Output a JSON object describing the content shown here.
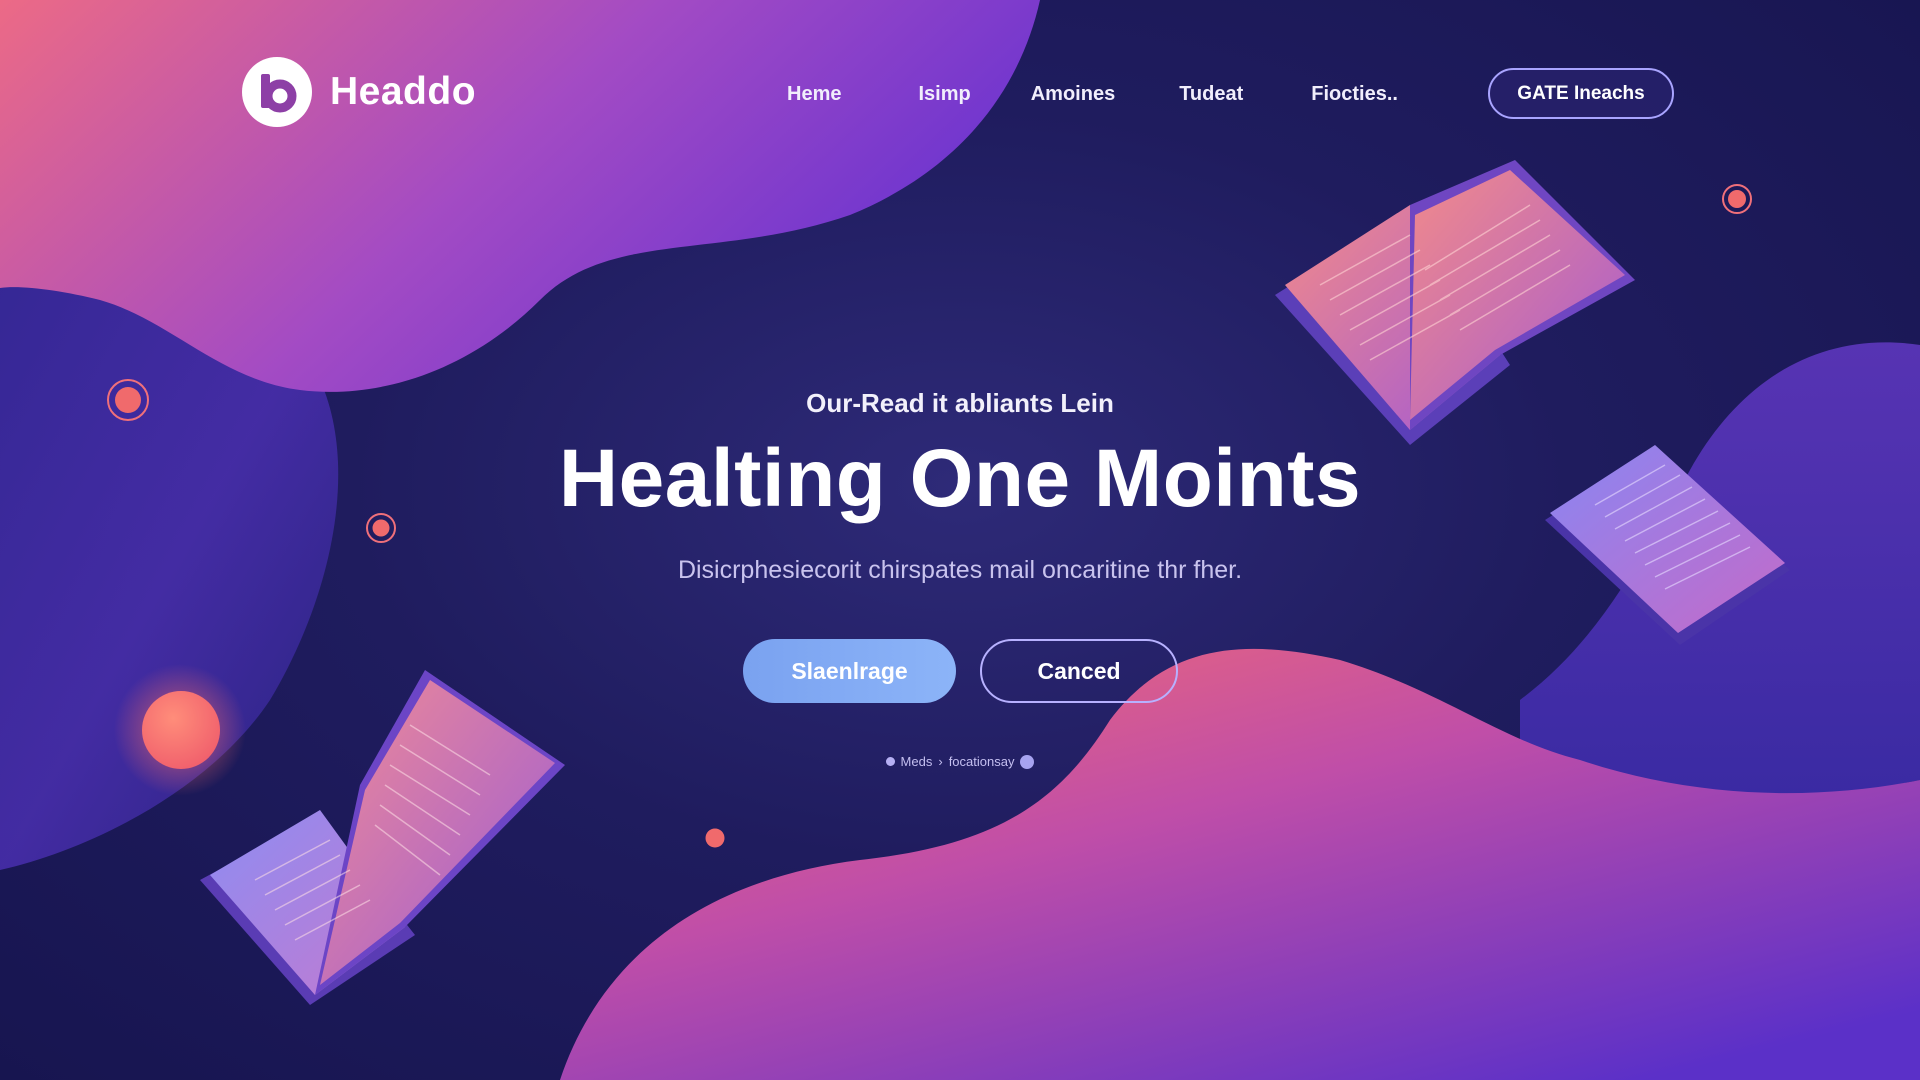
{
  "brand": {
    "name": "Headdo",
    "logo_icon": "b-letter-logo"
  },
  "nav": {
    "links": [
      {
        "label": "Heme"
      },
      {
        "label": "Isimp"
      },
      {
        "label": "Amoines"
      },
      {
        "label": "Tudeat"
      },
      {
        "label": "Fiocties.."
      }
    ],
    "cta_label": "GATE Ineachs"
  },
  "hero": {
    "eyebrow": "Our-Read it abliants Lein",
    "title": "Healting One Moints",
    "subtitle": "Disicrphesiecorit chirspates mail oncaritine thr fher.",
    "primary_button": "Slaenlrage",
    "secondary_button": "Canced",
    "breadcrumb_left": "Meds",
    "breadcrumb_sep": "›",
    "breadcrumb_right": "focationsay"
  },
  "colors": {
    "background": "#1f1c5e",
    "blob_pink": "#f06a78",
    "blob_purple": "#7b3fd0",
    "primary_button": "#86aef6",
    "accent_outline": "#b7b1ff"
  }
}
